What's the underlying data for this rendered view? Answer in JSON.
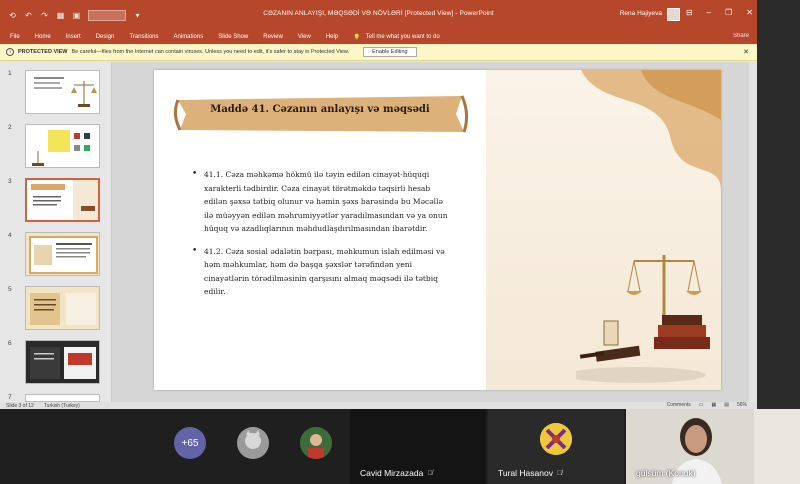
{
  "titlebar": {
    "doc_title": "CƏZANIN ANLAYIŞI, MƏQSƏDİ VƏ NÖVLƏRİ [Protected View] - PowerPoint",
    "user_name": "Rena Hajiyeva",
    "icons": [
      "save-icon",
      "undo-icon",
      "redo-icon",
      "present-icon",
      "minimize-icon",
      "restore-icon",
      "close-icon"
    ]
  },
  "ribbon": {
    "tabs": [
      "File",
      "Home",
      "Insert",
      "Design",
      "Transitions",
      "Animations",
      "Slide Show",
      "Review",
      "View",
      "Help"
    ],
    "tell_me": "Tell me what you want to do",
    "share": "Share"
  },
  "protected_view": {
    "label": "PROTECTED VIEW",
    "message": "Be careful—files from the Internet can contain viruses. Unless you need to edit, it's safer to stay in Protected View.",
    "button": "Enable Editing"
  },
  "thumbnails": [
    {
      "num": "1"
    },
    {
      "num": "2"
    },
    {
      "num": "3"
    },
    {
      "num": "4"
    },
    {
      "num": "5"
    },
    {
      "num": "6"
    },
    {
      "num": "7"
    }
  ],
  "slide": {
    "title": "Maddə 41. Cəzanın anlayışı və məqsədi",
    "bullets": [
      "41.1. Cəza məhkəmə hökmü ilə təyin edilən cinayət-hüquqi xarakterli tədbirdir. Cəza cinayət törətməkdə təqsirli hesab edilən şəxsə tətbiq olunur və həmin şəxs barəsində bu Məcəllə ilə müəyyən edilən məhrumiyyətlər yaradılmasından və ya onun hüquq və azadlıqlarının məhdudlaşdırılmasından ibarətdir.",
      "41.2. Cəza sosial ədalətin bərpası, məhkumun islah edilməsi və həm məhkumlar, həm də başqa şəxslər tərəfindən yeni cinayətlərin törədilməsinin qarşısını almaq məqsədi ilə tətbiq edilir."
    ]
  },
  "statusbar": {
    "slide_info": "Slide 3 of 12",
    "language": "Turkish (Turkey)",
    "comments": "Comments",
    "zoom": "56%"
  },
  "teams": {
    "more_count": "+65",
    "participants": [
      {
        "name": "Cavid Mirzazada"
      },
      {
        "name": "Tural Hasanov"
      },
      {
        "name": "gülsüm (Konuk)"
      }
    ]
  },
  "colors": {
    "ppt_accent": "#b7472a",
    "teams_purple": "#6264a7"
  }
}
